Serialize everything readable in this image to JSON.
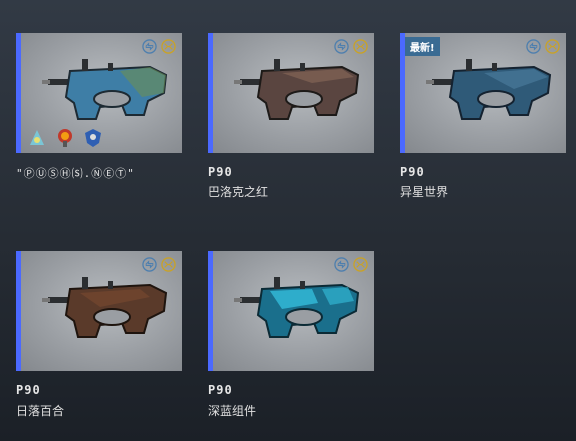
{
  "items": [
    {
      "weapon": "",
      "skin": "\"ⓅⓊⓈⒽ⒮.ⓃⒺⓉ\"",
      "rarity_color": "#4b69ff",
      "new": false,
      "gun_color": "#3e7ea6",
      "gun_accent": "#6d8f55",
      "stickers": [
        "sticker-1",
        "sticker-2",
        "sticker-3"
      ]
    },
    {
      "weapon": "P90",
      "skin": "巴洛克之红",
      "rarity_color": "#4b69ff",
      "new": false,
      "gun_color": "#5a4540",
      "gun_accent": "#8a6a5a",
      "stickers": []
    },
    {
      "weapon": "P90",
      "skin": "异星世界",
      "rarity_color": "#4b69ff",
      "new": true,
      "new_label": "最新!",
      "gun_color": "#2f5a78",
      "gun_accent": "#4f7fa0",
      "stickers": []
    },
    {
      "weapon": "P90",
      "skin": "日落百合",
      "rarity_color": "#4b69ff",
      "new": false,
      "gun_color": "#5a3a2a",
      "gun_accent": "#7a4a30",
      "stickers": []
    },
    {
      "weapon": "P90",
      "skin": "深蓝组件",
      "rarity_color": "#4b69ff",
      "new": false,
      "gun_color": "#1a6f8c",
      "gun_accent": "#38c8e6",
      "stickers": []
    }
  ],
  "icons": {
    "trade": "trade-icon",
    "market": "market-icon"
  }
}
